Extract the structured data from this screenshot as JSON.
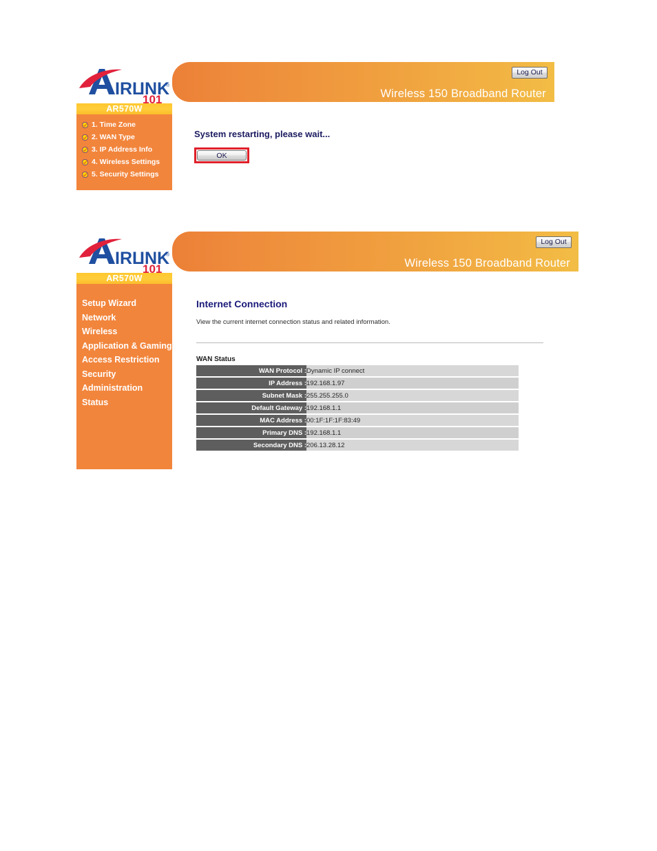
{
  "colors": {
    "header_gradient_left": "#ec8037",
    "header_gradient_right": "#f2bd45",
    "sidebar_orange": "#f2853c",
    "model_bar_yellow": "#ffc72e",
    "title_blue": "#1b1b7a",
    "annotation_red": "#e0202a",
    "table_key_gray": "#5e5e5e",
    "table_val_gray": "#d7d7d7"
  },
  "brand": {
    "logo_text_main": "AIRLINK",
    "logo_text_sub": "101",
    "logo_registered_mark": "®",
    "logo_blue": "#1f4fa0",
    "logo_red": "#e1213b"
  },
  "panel1": {
    "header": {
      "title": "Wireless 150 Broadband Router",
      "logout_label": "Log Out"
    },
    "sidebar": {
      "model": "AR570W",
      "steps": [
        {
          "label": "1. Time Zone"
        },
        {
          "label": "2. WAN Type"
        },
        {
          "label": "3. IP Address Info"
        },
        {
          "label": "4. Wireless Settings"
        },
        {
          "label": "5. Security Settings"
        }
      ]
    },
    "content": {
      "message": "System restarting, please wait...",
      "ok_label": "OK"
    }
  },
  "panel2": {
    "header": {
      "title": "Wireless 150 Broadband Router",
      "logout_label": "Log Out"
    },
    "sidebar": {
      "model": "AR570W",
      "nav": [
        {
          "label": "Setup Wizard"
        },
        {
          "label": "Network"
        },
        {
          "label": "Wireless"
        },
        {
          "label": "Application & Gaming"
        },
        {
          "label": "Access Restriction"
        },
        {
          "label": "Security"
        },
        {
          "label": "Administration"
        },
        {
          "label": "Status"
        }
      ]
    },
    "content": {
      "page_title": "Internet Connection",
      "page_desc": "View the current internet connection status and related information.",
      "section_label": "WAN Status",
      "wan_status": [
        {
          "key": "WAN Protocol :",
          "value": "Dynamic IP connect"
        },
        {
          "key": "IP Address :",
          "value": "192.168.1.97"
        },
        {
          "key": "Subnet Mask :",
          "value": "255.255.255.0"
        },
        {
          "key": "Default Gateway :",
          "value": "192.168.1.1"
        },
        {
          "key": "MAC Address :",
          "value": "00:1F:1F:1F:83:49"
        },
        {
          "key": "Primary DNS :",
          "value": "192.168.1.1"
        },
        {
          "key": "Secondary DNS :",
          "value": "206.13.28.12"
        }
      ]
    }
  }
}
